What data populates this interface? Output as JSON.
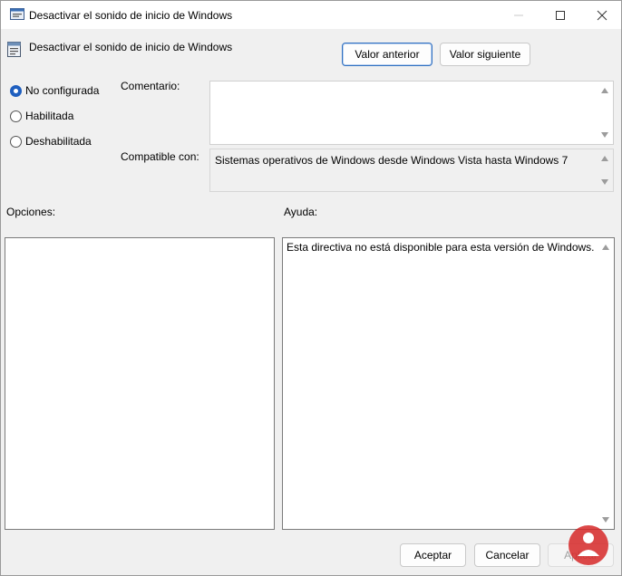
{
  "window": {
    "title": "Desactivar el sonido de inicio de Windows",
    "controls": {
      "minimize": "minimize-icon",
      "maximize": "maximize-icon",
      "close": "close-icon"
    }
  },
  "header": {
    "policy_name": "Desactivar el sonido de inicio de Windows",
    "prev_button": "Valor anterior",
    "next_button": "Valor siguiente"
  },
  "state": {
    "options": [
      {
        "label": "No configurada",
        "selected": true
      },
      {
        "label": "Habilitada",
        "selected": false
      },
      {
        "label": "Deshabilitada",
        "selected": false
      }
    ]
  },
  "comment": {
    "label": "Comentario:",
    "value": ""
  },
  "compatibility": {
    "label": "Compatible con:",
    "value": "Sistemas operativos de Windows desde Windows Vista hasta Windows 7"
  },
  "options_panel": {
    "label": "Opciones:"
  },
  "help_panel": {
    "label": "Ayuda:",
    "text": "Esta directiva no está disponible para esta versión de Windows."
  },
  "footer": {
    "ok_button": "Aceptar",
    "cancel_button": "Cancelar",
    "apply_button": "Aplicar"
  },
  "colors": {
    "accent": "#1f5fbf",
    "watermark": "#d62828"
  }
}
